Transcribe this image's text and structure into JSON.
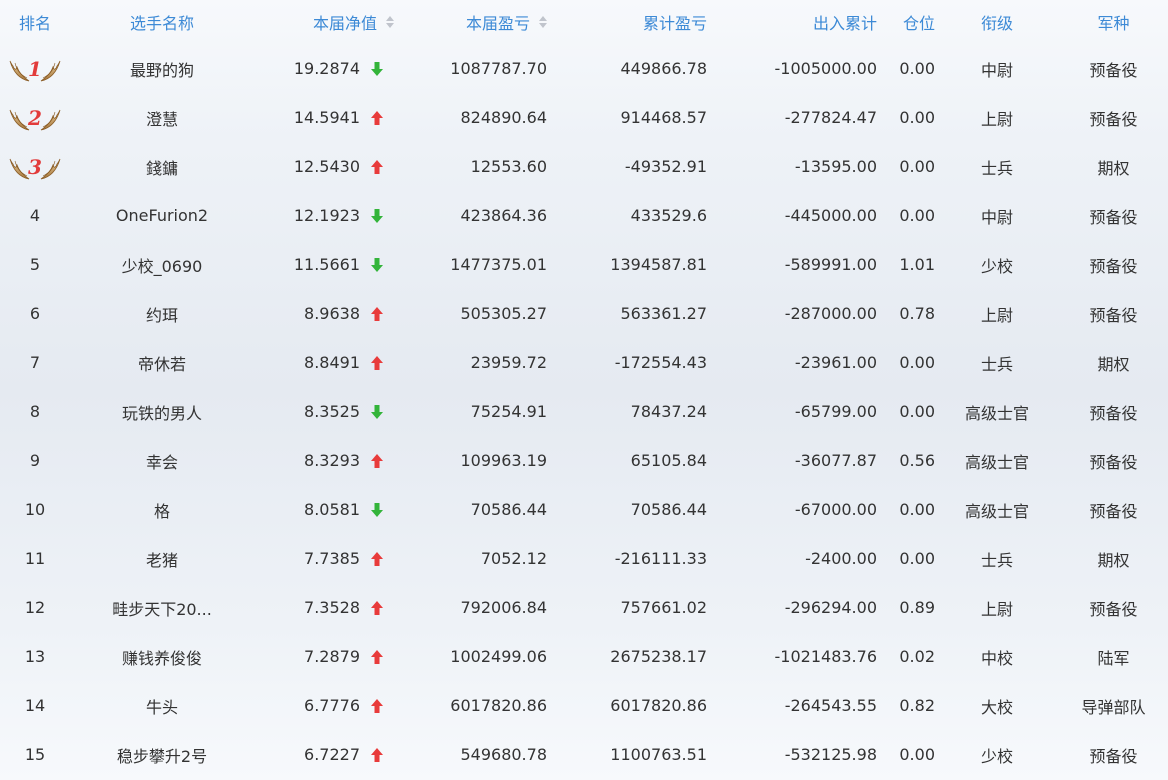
{
  "columns": {
    "rank": "排名",
    "name": "选手名称",
    "nav": "本届净值",
    "pnl": "本届盈亏",
    "cum": "累计盈亏",
    "io": "出入累计",
    "pos": "仓位",
    "title": "衔级",
    "arm": "军种"
  },
  "colors": {
    "header": "#3d8ad6",
    "up": "#e83b3b",
    "down": "#33b43a",
    "medal_num": "#e23b3b"
  },
  "rows": [
    {
      "rank": "1",
      "medal": true,
      "name": "最野的狗",
      "nav": "19.2874",
      "trend": "down",
      "pnl": "1087787.70",
      "cum": "449866.78",
      "io": "-1005000.00",
      "pos": "0.00",
      "title": "中尉",
      "arm": "预备役"
    },
    {
      "rank": "2",
      "medal": true,
      "name": "澄慧",
      "nav": "14.5941",
      "trend": "up",
      "pnl": "824890.64",
      "cum": "914468.57",
      "io": "-277824.47",
      "pos": "0.00",
      "title": "上尉",
      "arm": "预备役"
    },
    {
      "rank": "3",
      "medal": true,
      "name": "錢鏞",
      "nav": "12.5430",
      "trend": "up",
      "pnl": "12553.60",
      "cum": "-49352.91",
      "io": "-13595.00",
      "pos": "0.00",
      "title": "士兵",
      "arm": "期权"
    },
    {
      "rank": "4",
      "medal": false,
      "name": "OneFurion2",
      "nav": "12.1923",
      "trend": "down",
      "pnl": "423864.36",
      "cum": "433529.6",
      "io": "-445000.00",
      "pos": "0.00",
      "title": "中尉",
      "arm": "预备役"
    },
    {
      "rank": "5",
      "medal": false,
      "name": "少校_0690",
      "nav": "11.5661",
      "trend": "down",
      "pnl": "1477375.01",
      "cum": "1394587.81",
      "io": "-589991.00",
      "pos": "1.01",
      "title": "少校",
      "arm": "预备役"
    },
    {
      "rank": "6",
      "medal": false,
      "name": "约珥",
      "nav": "8.9638",
      "trend": "up",
      "pnl": "505305.27",
      "cum": "563361.27",
      "io": "-287000.00",
      "pos": "0.78",
      "title": "上尉",
      "arm": "预备役"
    },
    {
      "rank": "7",
      "medal": false,
      "name": "帝休若",
      "nav": "8.8491",
      "trend": "up",
      "pnl": "23959.72",
      "cum": "-172554.43",
      "io": "-23961.00",
      "pos": "0.00",
      "title": "士兵",
      "arm": "期权"
    },
    {
      "rank": "8",
      "medal": false,
      "name": "玩铁的男人",
      "nav": "8.3525",
      "trend": "down",
      "pnl": "75254.91",
      "cum": "78437.24",
      "io": "-65799.00",
      "pos": "0.00",
      "title": "高级士官",
      "arm": "预备役"
    },
    {
      "rank": "9",
      "medal": false,
      "name": "幸会",
      "nav": "8.3293",
      "trend": "up",
      "pnl": "109963.19",
      "cum": "65105.84",
      "io": "-36077.87",
      "pos": "0.56",
      "title": "高级士官",
      "arm": "预备役"
    },
    {
      "rank": "10",
      "medal": false,
      "name": "格",
      "nav": "8.0581",
      "trend": "down",
      "pnl": "70586.44",
      "cum": "70586.44",
      "io": "-67000.00",
      "pos": "0.00",
      "title": "高级士官",
      "arm": "预备役"
    },
    {
      "rank": "11",
      "medal": false,
      "name": "老猪",
      "nav": "7.7385",
      "trend": "up",
      "pnl": "7052.12",
      "cum": "-216111.33",
      "io": "-2400.00",
      "pos": "0.00",
      "title": "士兵",
      "arm": "期权"
    },
    {
      "rank": "12",
      "medal": false,
      "name": "畦步天下20...",
      "nav": "7.3528",
      "trend": "up",
      "pnl": "792006.84",
      "cum": "757661.02",
      "io": "-296294.00",
      "pos": "0.89",
      "title": "上尉",
      "arm": "预备役"
    },
    {
      "rank": "13",
      "medal": false,
      "name": "赚钱养俊俊",
      "nav": "7.2879",
      "trend": "up",
      "pnl": "1002499.06",
      "cum": "2675238.17",
      "io": "-1021483.76",
      "pos": "0.02",
      "title": "中校",
      "arm": "陆军"
    },
    {
      "rank": "14",
      "medal": false,
      "name": "牛头",
      "nav": "6.7776",
      "trend": "up",
      "pnl": "6017820.86",
      "cum": "6017820.86",
      "io": "-264543.55",
      "pos": "0.82",
      "title": "大校",
      "arm": "导弹部队"
    },
    {
      "rank": "15",
      "medal": false,
      "name": "稳步攀升2号",
      "nav": "6.7227",
      "trend": "up",
      "pnl": "549680.78",
      "cum": "1100763.51",
      "io": "-532125.98",
      "pos": "0.00",
      "title": "少校",
      "arm": "预备役"
    }
  ]
}
